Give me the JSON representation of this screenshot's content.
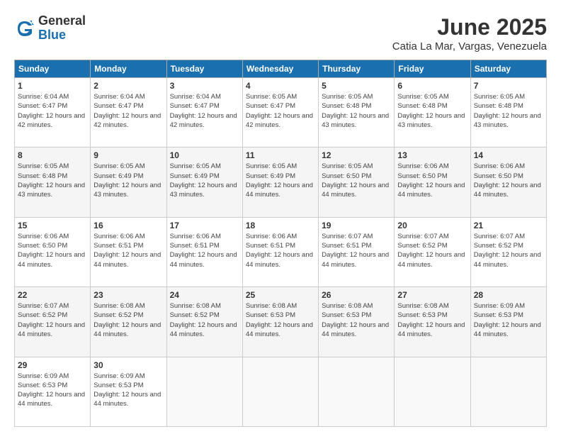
{
  "logo": {
    "general": "General",
    "blue": "Blue"
  },
  "title": "June 2025",
  "location": "Catia La Mar, Vargas, Venezuela",
  "weekdays": [
    "Sunday",
    "Monday",
    "Tuesday",
    "Wednesday",
    "Thursday",
    "Friday",
    "Saturday"
  ],
  "weeks": [
    [
      {
        "day": 1,
        "rise": "6:04 AM",
        "set": "6:47 PM",
        "daylight": "12 hours and 42 minutes"
      },
      {
        "day": 2,
        "rise": "6:04 AM",
        "set": "6:47 PM",
        "daylight": "12 hours and 42 minutes"
      },
      {
        "day": 3,
        "rise": "6:04 AM",
        "set": "6:47 PM",
        "daylight": "12 hours and 42 minutes"
      },
      {
        "day": 4,
        "rise": "6:05 AM",
        "set": "6:47 PM",
        "daylight": "12 hours and 42 minutes"
      },
      {
        "day": 5,
        "rise": "6:05 AM",
        "set": "6:48 PM",
        "daylight": "12 hours and 43 minutes"
      },
      {
        "day": 6,
        "rise": "6:05 AM",
        "set": "6:48 PM",
        "daylight": "12 hours and 43 minutes"
      },
      {
        "day": 7,
        "rise": "6:05 AM",
        "set": "6:48 PM",
        "daylight": "12 hours and 43 minutes"
      }
    ],
    [
      {
        "day": 8,
        "rise": "6:05 AM",
        "set": "6:48 PM",
        "daylight": "12 hours and 43 minutes"
      },
      {
        "day": 9,
        "rise": "6:05 AM",
        "set": "6:49 PM",
        "daylight": "12 hours and 43 minutes"
      },
      {
        "day": 10,
        "rise": "6:05 AM",
        "set": "6:49 PM",
        "daylight": "12 hours and 43 minutes"
      },
      {
        "day": 11,
        "rise": "6:05 AM",
        "set": "6:49 PM",
        "daylight": "12 hours and 44 minutes"
      },
      {
        "day": 12,
        "rise": "6:05 AM",
        "set": "6:50 PM",
        "daylight": "12 hours and 44 minutes"
      },
      {
        "day": 13,
        "rise": "6:06 AM",
        "set": "6:50 PM",
        "daylight": "12 hours and 44 minutes"
      },
      {
        "day": 14,
        "rise": "6:06 AM",
        "set": "6:50 PM",
        "daylight": "12 hours and 44 minutes"
      }
    ],
    [
      {
        "day": 15,
        "rise": "6:06 AM",
        "set": "6:50 PM",
        "daylight": "12 hours and 44 minutes"
      },
      {
        "day": 16,
        "rise": "6:06 AM",
        "set": "6:51 PM",
        "daylight": "12 hours and 44 minutes"
      },
      {
        "day": 17,
        "rise": "6:06 AM",
        "set": "6:51 PM",
        "daylight": "12 hours and 44 minutes"
      },
      {
        "day": 18,
        "rise": "6:06 AM",
        "set": "6:51 PM",
        "daylight": "12 hours and 44 minutes"
      },
      {
        "day": 19,
        "rise": "6:07 AM",
        "set": "6:51 PM",
        "daylight": "12 hours and 44 minutes"
      },
      {
        "day": 20,
        "rise": "6:07 AM",
        "set": "6:52 PM",
        "daylight": "12 hours and 44 minutes"
      },
      {
        "day": 21,
        "rise": "6:07 AM",
        "set": "6:52 PM",
        "daylight": "12 hours and 44 minutes"
      }
    ],
    [
      {
        "day": 22,
        "rise": "6:07 AM",
        "set": "6:52 PM",
        "daylight": "12 hours and 44 minutes"
      },
      {
        "day": 23,
        "rise": "6:08 AM",
        "set": "6:52 PM",
        "daylight": "12 hours and 44 minutes"
      },
      {
        "day": 24,
        "rise": "6:08 AM",
        "set": "6:52 PM",
        "daylight": "12 hours and 44 minutes"
      },
      {
        "day": 25,
        "rise": "6:08 AM",
        "set": "6:53 PM",
        "daylight": "12 hours and 44 minutes"
      },
      {
        "day": 26,
        "rise": "6:08 AM",
        "set": "6:53 PM",
        "daylight": "12 hours and 44 minutes"
      },
      {
        "day": 27,
        "rise": "6:08 AM",
        "set": "6:53 PM",
        "daylight": "12 hours and 44 minutes"
      },
      {
        "day": 28,
        "rise": "6:09 AM",
        "set": "6:53 PM",
        "daylight": "12 hours and 44 minutes"
      }
    ],
    [
      {
        "day": 29,
        "rise": "6:09 AM",
        "set": "6:53 PM",
        "daylight": "12 hours and 44 minutes"
      },
      {
        "day": 30,
        "rise": "6:09 AM",
        "set": "6:53 PM",
        "daylight": "12 hours and 44 minutes"
      },
      null,
      null,
      null,
      null,
      null
    ]
  ]
}
